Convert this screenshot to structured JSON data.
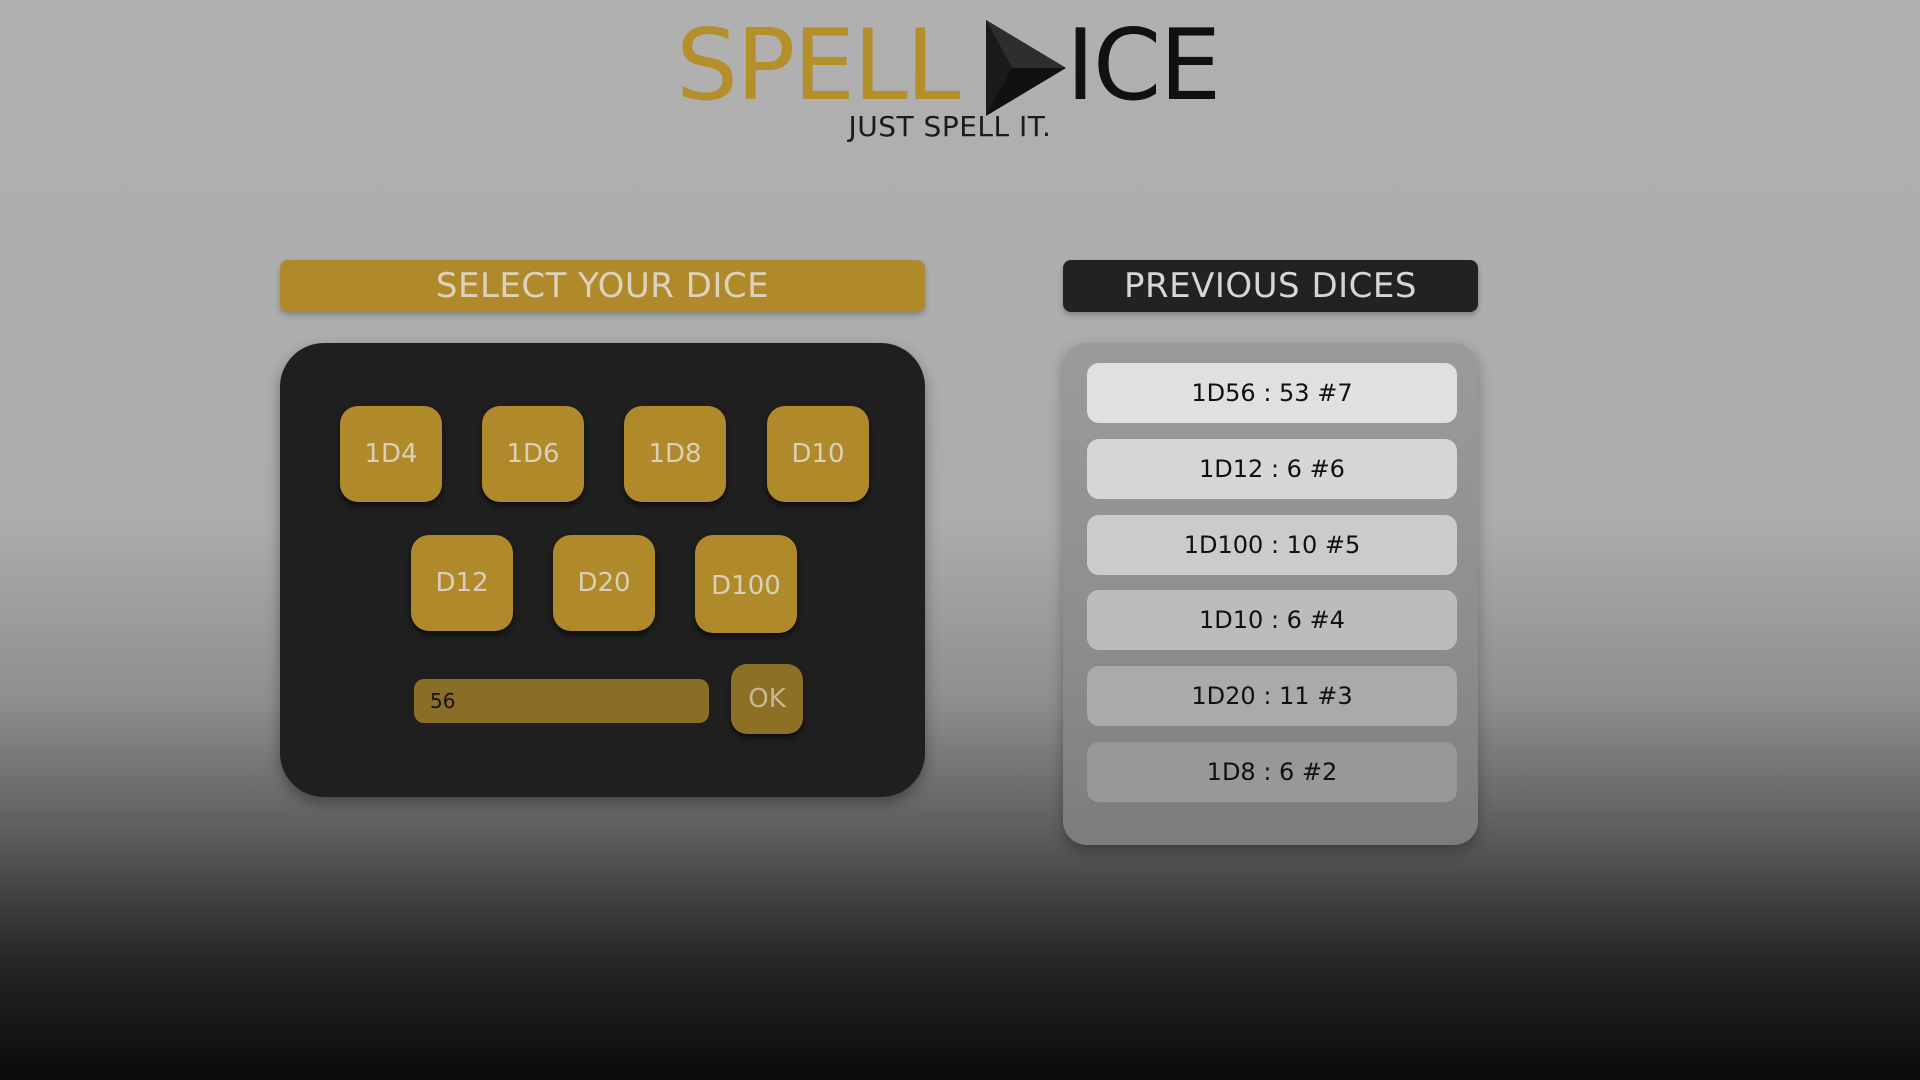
{
  "logo": {
    "word_left": "SPELL",
    "word_right": "ICE",
    "icon": "play-triangle-icon",
    "tagline": "JUST SPELL IT."
  },
  "select_section": {
    "title": "SELECT YOUR DICE",
    "dice": [
      "1D4",
      "1D6",
      "1D8",
      "D10",
      "D12",
      "D20",
      "D100"
    ],
    "input_value": "56",
    "ok_label": "OK"
  },
  "previous_section": {
    "title": "PREVIOUS DICES",
    "items": [
      "1D56 : 53 #7",
      "1D12 : 6 #6",
      "1D100 : 10 #5",
      "1D10 : 6 #4",
      "1D20 : 11 #3",
      "1D8 : 6 #2"
    ]
  },
  "colors": {
    "gold": "#b08a2a",
    "dark_panel": "#1f1f1f",
    "history_item_backgrounds": [
      "#e0e0e0",
      "#d6d6d6",
      "#cbcbcb",
      "#bcbcbc",
      "#aaaaaa",
      "#989898"
    ]
  }
}
